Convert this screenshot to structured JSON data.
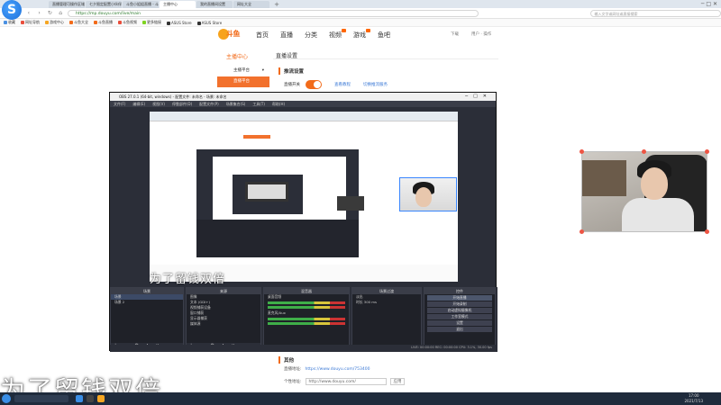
{
  "browser": {
    "tabs": [
      {
        "label": "直播管理可操作区域"
      },
      {
        "label": "七夕限定配置小伙伴有你在"
      },
      {
        "label": "斗鱼小姐姐直播 - 斗鱼"
      },
      {
        "label": "主播中心"
      },
      {
        "label": "我的直播间设置"
      },
      {
        "label": "网址大全"
      }
    ],
    "new_tab": "+",
    "url": "https://mp.douyu.com/live/main",
    "search_placeholder": "输入文字或网址或直接搜索",
    "bookmarks": [
      "收藏",
      "网址导航",
      "游戏中心",
      "斗鱼大全",
      "斗鱼直播",
      "斗鱼视频",
      "更多链接",
      "ASUS Store",
      "ASUS Store"
    ],
    "win_controls": "─ □ ✕"
  },
  "site": {
    "logo_text": "斗鱼",
    "nav": [
      "首页",
      "直播",
      "分类",
      "视频",
      "游戏",
      "鱼吧"
    ],
    "right_links": [
      "下载",
      "用户 · 操作"
    ]
  },
  "sidebar": {
    "title": "主播中心",
    "items": [
      {
        "label": "主播平台",
        "chev": "▾"
      },
      {
        "label": "直播平台",
        "active": true
      }
    ]
  },
  "content": {
    "title": "直播设置",
    "section": "推流设置",
    "toggle_label": "直播开关",
    "links": [
      "查看教程",
      "切换推流服务"
    ]
  },
  "other": {
    "heading": "其他",
    "share_label": "直播地址:",
    "share_value": "https://www.douyu.com/753400",
    "room_label": "个性地址:",
    "room_value": "http://www.douyu.com/",
    "room_action": "应用"
  },
  "obs": {
    "title": "OBS 27.0.1 (64-bit, windows) - 配置文件: 未命名 - 场景: 未命名",
    "menu": [
      "文件(F)",
      "编辑(E)",
      "视图(V)",
      "停靠部件(D)",
      "配置文件(P)",
      "场景集合(S)",
      "工具(T)",
      "帮助(H)"
    ],
    "preview_label": "来源预览",
    "scenes": {
      "head": "场景",
      "rows": [
        "场景",
        "场景 2"
      ]
    },
    "sources": {
      "head": "来源",
      "rows": [
        "图像",
        "文本 (GDI+)",
        "视频捕获设备",
        "窗口捕获",
        "显示器捕获",
        "媒体源"
      ]
    },
    "mixer": {
      "head": "混音器",
      "rows": [
        "桌面音频",
        "麦克风/Aux"
      ]
    },
    "transitions": {
      "head": "场景过渡",
      "rows": [
        "淡出",
        "时长 300 ms"
      ]
    },
    "controls": {
      "head": "控件",
      "rows": [
        "开始直播",
        "开始录制",
        "启动虚拟摄像机",
        "工作室模式",
        "设置",
        "退出"
      ]
    },
    "status": "LIVE: 00:00:00   REC: 00:00:00   CPU: 3.1%, 30.00 fps",
    "dock_foot": "+ − ⚙ ∧ ∨"
  },
  "overlay_text_small": "为了留钱双倍",
  "overlay_text_large": "为了留钱双倍",
  "taskbar": {
    "time": "17:00",
    "date": "2021/7/13"
  }
}
